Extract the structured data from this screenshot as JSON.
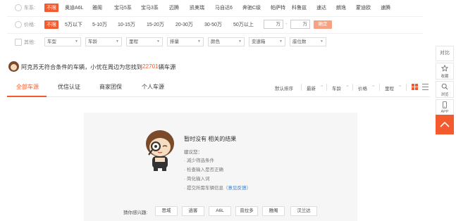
{
  "filters": {
    "brand": {
      "label": "车系:",
      "options": [
        "不限",
        "奥迪A6L",
        "雅阁",
        "宝马5系",
        "宝马3系",
        "迈腾",
        "凯美瑞",
        "马自达6",
        "奔驰C级",
        "帕萨特",
        "科鲁兹",
        "速达",
        "朗逸",
        "蒙迪欧",
        "速腾"
      ]
    },
    "price": {
      "label": "价格:",
      "options": [
        "不限",
        "5万以下",
        "5-10万",
        "10-15万",
        "15-20万",
        "20-30万",
        "30-50万",
        "50万以上"
      ],
      "min_unit": "万",
      "max_unit": "万",
      "dash": "-",
      "confirm": "确定"
    },
    "other": {
      "label": "其他:",
      "dropdowns": [
        "车型",
        "车龄",
        "里程",
        "排量",
        "颜色",
        "变速箱",
        "座位数"
      ]
    }
  },
  "notice": {
    "prefix": "阿克苏无符合条件的车辆，小优在周边为您找到",
    "count": "22701",
    "suffix": "辆车源"
  },
  "tabs": [
    "全部车源",
    "优信认证",
    "商家团保",
    "个人车源"
  ],
  "sorts": [
    "默认排序",
    "最新",
    "车龄",
    "价格",
    "里程"
  ],
  "empty": {
    "title": "暂时没有 相关的结果",
    "hint_head": "建议您：",
    "hints": [
      "· 减少筛选条件",
      "· 检查输入是否正确",
      "· 简化输入词"
    ],
    "feedback_prefix": "· 提交所需车辆信息（",
    "feedback_link": "意见反馈",
    "feedback_suffix": "）"
  },
  "interest": {
    "label": "猜你感兴趣:",
    "chips": [
      "思域",
      "逍客",
      "A6L",
      "普拉多",
      "雅阁",
      "汉兰达"
    ]
  },
  "sidebar": {
    "compare": "对比",
    "favorite": "收藏",
    "browse": "浏览",
    "app": "APP"
  },
  "colors": {
    "accent": "#f35b2f",
    "link": "#2f7fd8"
  }
}
